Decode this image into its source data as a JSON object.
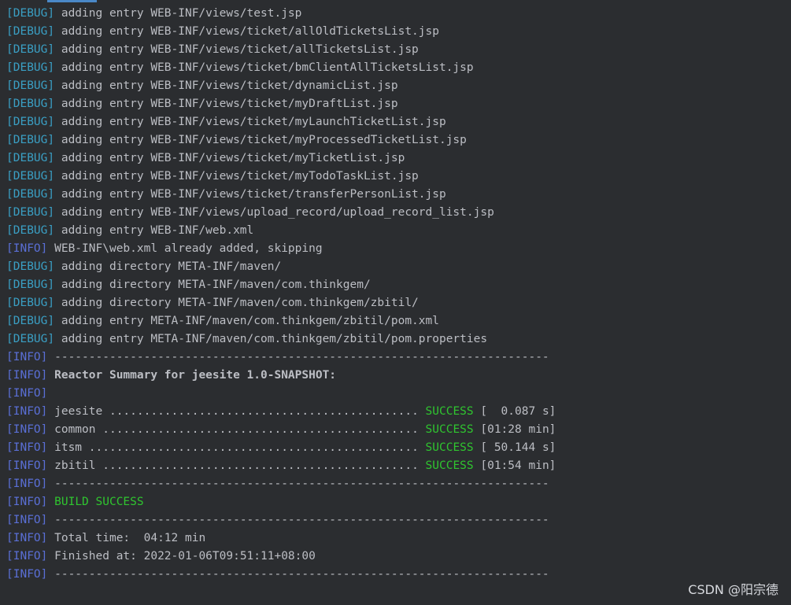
{
  "console": {
    "lines": [
      {
        "level": "[DEBUG]",
        "text": " adding entry WEB-INF/views/test.jsp"
      },
      {
        "level": "[DEBUG]",
        "text": " adding entry WEB-INF/views/ticket/allOldTicketsList.jsp"
      },
      {
        "level": "[DEBUG]",
        "text": " adding entry WEB-INF/views/ticket/allTicketsList.jsp"
      },
      {
        "level": "[DEBUG]",
        "text": " adding entry WEB-INF/views/ticket/bmClientAllTicketsList.jsp"
      },
      {
        "level": "[DEBUG]",
        "text": " adding entry WEB-INF/views/ticket/dynamicList.jsp"
      },
      {
        "level": "[DEBUG]",
        "text": " adding entry WEB-INF/views/ticket/myDraftList.jsp"
      },
      {
        "level": "[DEBUG]",
        "text": " adding entry WEB-INF/views/ticket/myLaunchTicketList.jsp"
      },
      {
        "level": "[DEBUG]",
        "text": " adding entry WEB-INF/views/ticket/myProcessedTicketList.jsp"
      },
      {
        "level": "[DEBUG]",
        "text": " adding entry WEB-INF/views/ticket/myTicketList.jsp"
      },
      {
        "level": "[DEBUG]",
        "text": " adding entry WEB-INF/views/ticket/myTodoTaskList.jsp"
      },
      {
        "level": "[DEBUG]",
        "text": " adding entry WEB-INF/views/ticket/transferPersonList.jsp"
      },
      {
        "level": "[DEBUG]",
        "text": " adding entry WEB-INF/views/upload_record/upload_record_list.jsp"
      },
      {
        "level": "[DEBUG]",
        "text": " adding entry WEB-INF/web.xml"
      },
      {
        "level": "[INFO]",
        "text": " WEB-INF\\web.xml already added, skipping"
      },
      {
        "level": "[DEBUG]",
        "text": " adding directory META-INF/maven/"
      },
      {
        "level": "[DEBUG]",
        "text": " adding directory META-INF/maven/com.thinkgem/"
      },
      {
        "level": "[DEBUG]",
        "text": " adding directory META-INF/maven/com.thinkgem/zbitil/"
      },
      {
        "level": "[DEBUG]",
        "text": " adding entry META-INF/maven/com.thinkgem/zbitil/pom.xml"
      },
      {
        "level": "[DEBUG]",
        "text": " adding entry META-INF/maven/com.thinkgem/zbitil/pom.properties"
      },
      {
        "level": "[INFO]",
        "text": " ------------------------------------------------------------------------"
      },
      {
        "level": "[INFO]",
        "text": " Reactor Summary for jeesite 1.0-SNAPSHOT:",
        "style": "bold"
      },
      {
        "level": "[INFO]",
        "text": ""
      },
      {
        "level": "[INFO]",
        "text": " jeesite ............................................. ",
        "status": "SUCCESS",
        "time": " [  0.087 s]"
      },
      {
        "level": "[INFO]",
        "text": " common .............................................. ",
        "status": "SUCCESS",
        "time": " [01:28 min]"
      },
      {
        "level": "[INFO]",
        "text": " itsm ................................................ ",
        "status": "SUCCESS",
        "time": " [ 50.144 s]"
      },
      {
        "level": "[INFO]",
        "text": " zbitil .............................................. ",
        "status": "SUCCESS",
        "time": " [01:54 min]"
      },
      {
        "level": "[INFO]",
        "text": " ------------------------------------------------------------------------"
      },
      {
        "level": "[INFO]",
        "text": " ",
        "status": "BUILD SUCCESS"
      },
      {
        "level": "[INFO]",
        "text": " ------------------------------------------------------------------------"
      },
      {
        "level": "[INFO]",
        "text": " Total time:  04:12 min"
      },
      {
        "level": "[INFO]",
        "text": " Finished at: 2022-01-06T09:51:11+08:00"
      },
      {
        "level": "[INFO]",
        "text": " ------------------------------------------------------------------------"
      }
    ]
  },
  "watermark": "CSDN @阳宗德",
  "colors": {
    "background": "#2b2d30",
    "text": "#bcbec4",
    "debug_tag": "#3a9fc4",
    "info_tag": "#5a6fd6",
    "success": "#2fc52f",
    "tab_indicator": "#4a88c7"
  }
}
